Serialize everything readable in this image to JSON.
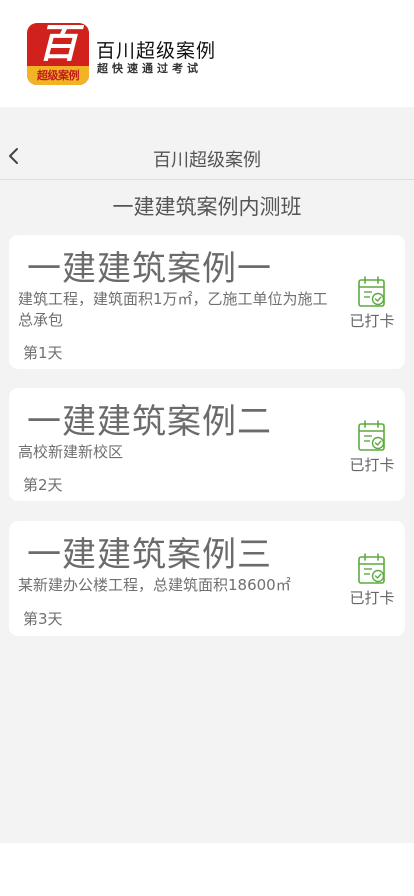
{
  "brand": {
    "logo_glyph": "百",
    "logo_band_text": "超级案例",
    "name": "百川超级案例",
    "slogan": "超快速通过考试"
  },
  "nav": {
    "title": "百川超级案例",
    "back_icon": "chevron-left-icon"
  },
  "section": {
    "title": "一建建筑案例内测班"
  },
  "cards": [
    {
      "title": "一建建筑案例一",
      "description": "建筑工程，建筑面积1万㎡，乙施工单位为施工总承包",
      "day": "第1天",
      "status": "已打卡"
    },
    {
      "title": "一建建筑案例二",
      "description": "高校新建新校区",
      "day": "第2天",
      "status": "已打卡"
    },
    {
      "title": "一建建筑案例三",
      "description": "某新建办公楼工程，总建筑面积18600㎡",
      "day": "第3天",
      "status": "已打卡"
    }
  ],
  "colors": {
    "accent_green": "#5cab3f",
    "logo_red": "#d0211c",
    "logo_yellow": "#f3b327",
    "background": "#f3f3f3"
  }
}
